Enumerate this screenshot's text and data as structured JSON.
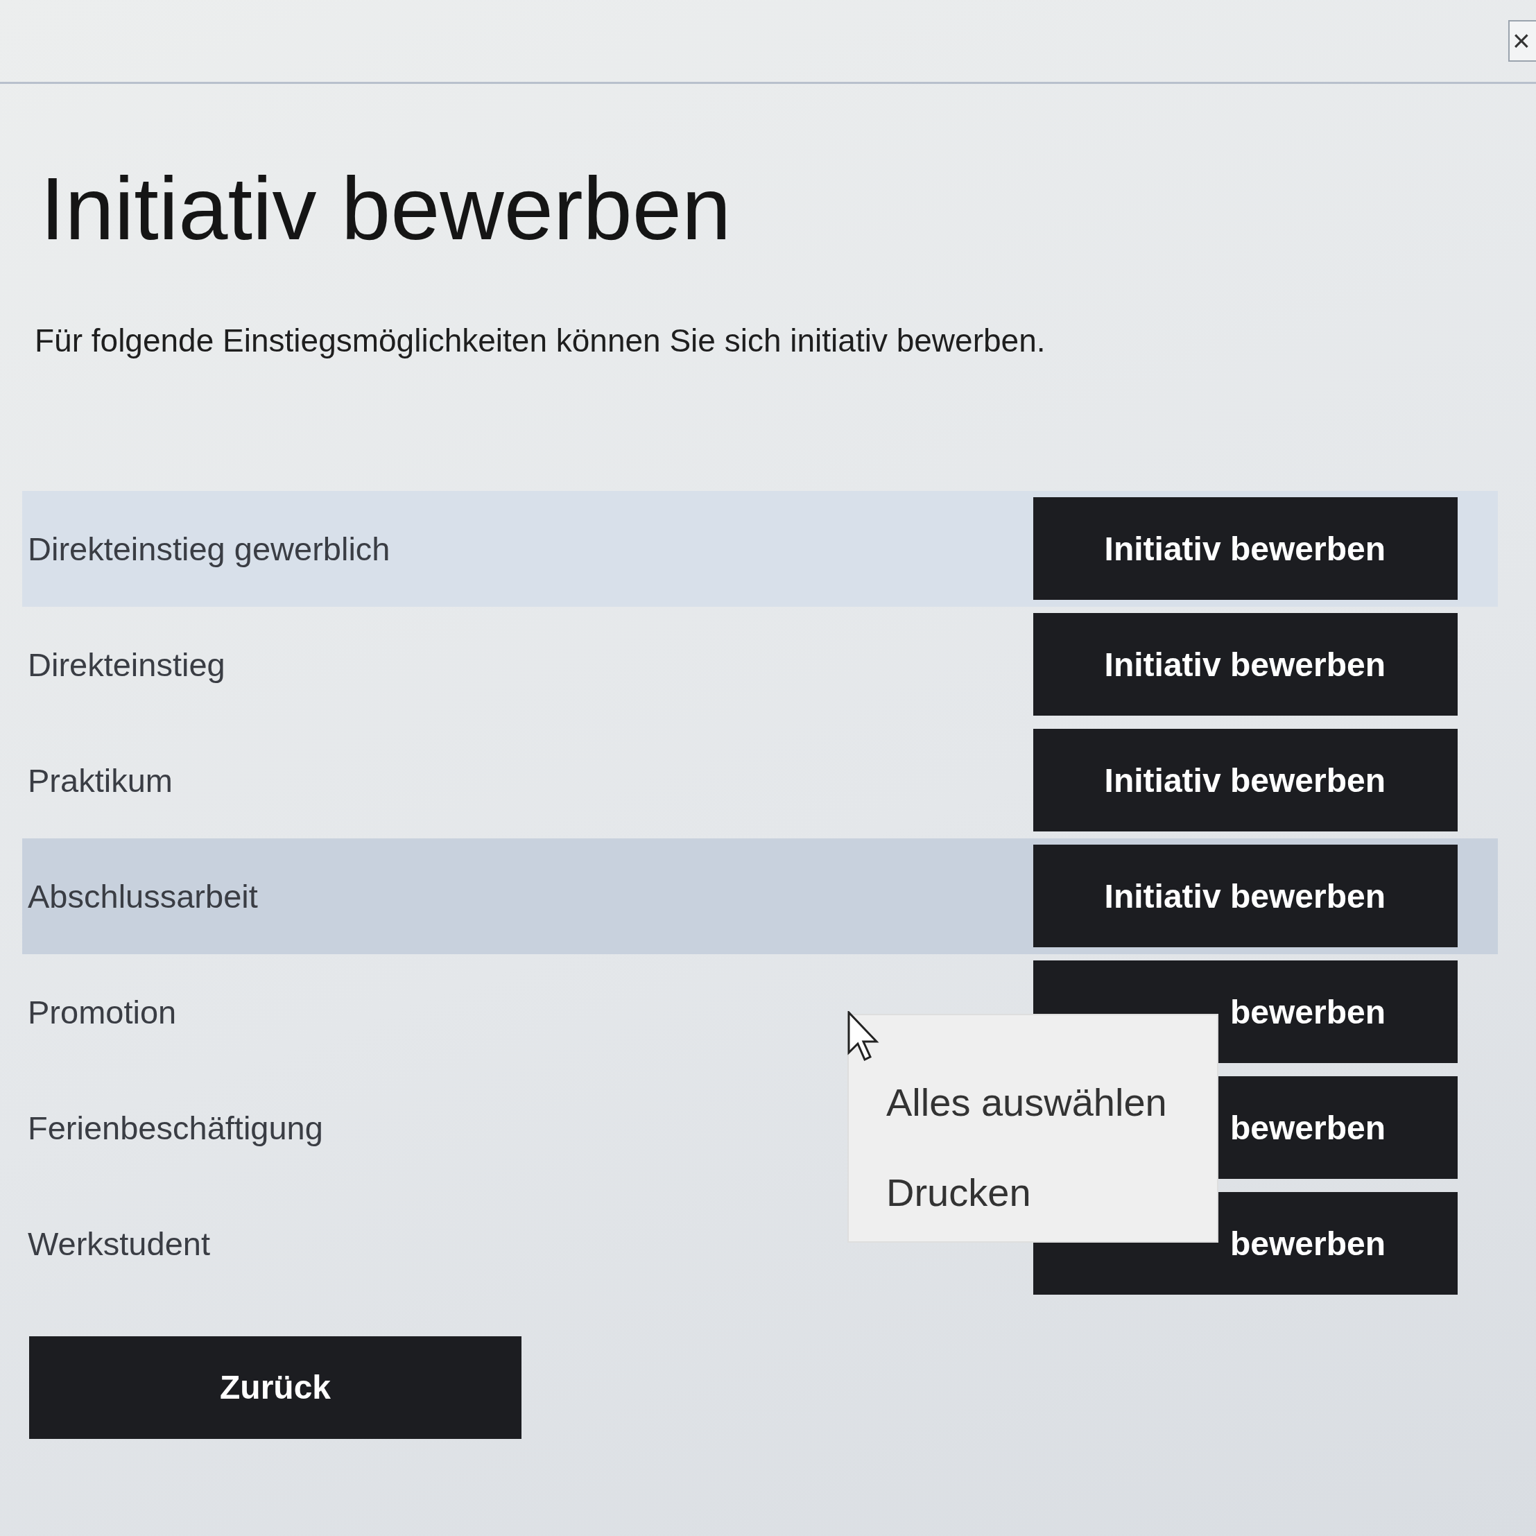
{
  "window": {
    "close": "×"
  },
  "title": "Initiativ bewerben",
  "intro": "Für folgende Einstiegsmöglichkeiten können Sie sich initiativ bewerben.",
  "rows": [
    {
      "label": "Direkteinstieg gewerblich",
      "button": "Initiativ bewerben",
      "highlighted": false,
      "hovered": true
    },
    {
      "label": "Direkteinstieg",
      "button": "Initiativ bewerben",
      "highlighted": false,
      "hovered": false
    },
    {
      "label": "Praktikum",
      "button": "Initiativ bewerben",
      "highlighted": false,
      "hovered": false
    },
    {
      "label": "Abschlussarbeit",
      "button": "Initiativ bewerben",
      "highlighted": true,
      "hovered": false
    },
    {
      "label": "Promotion",
      "button": "bewerben",
      "highlighted": false,
      "hovered": false
    },
    {
      "label": "Ferienbeschäftigung",
      "button": "bewerben",
      "highlighted": false,
      "hovered": false
    },
    {
      "label": "Werkstudent",
      "button": "bewerben",
      "highlighted": false,
      "hovered": false
    }
  ],
  "back_button": "Zurück",
  "context_menu": {
    "items": [
      {
        "label": "Alles auswählen"
      },
      {
        "label": "Drucken"
      }
    ]
  }
}
